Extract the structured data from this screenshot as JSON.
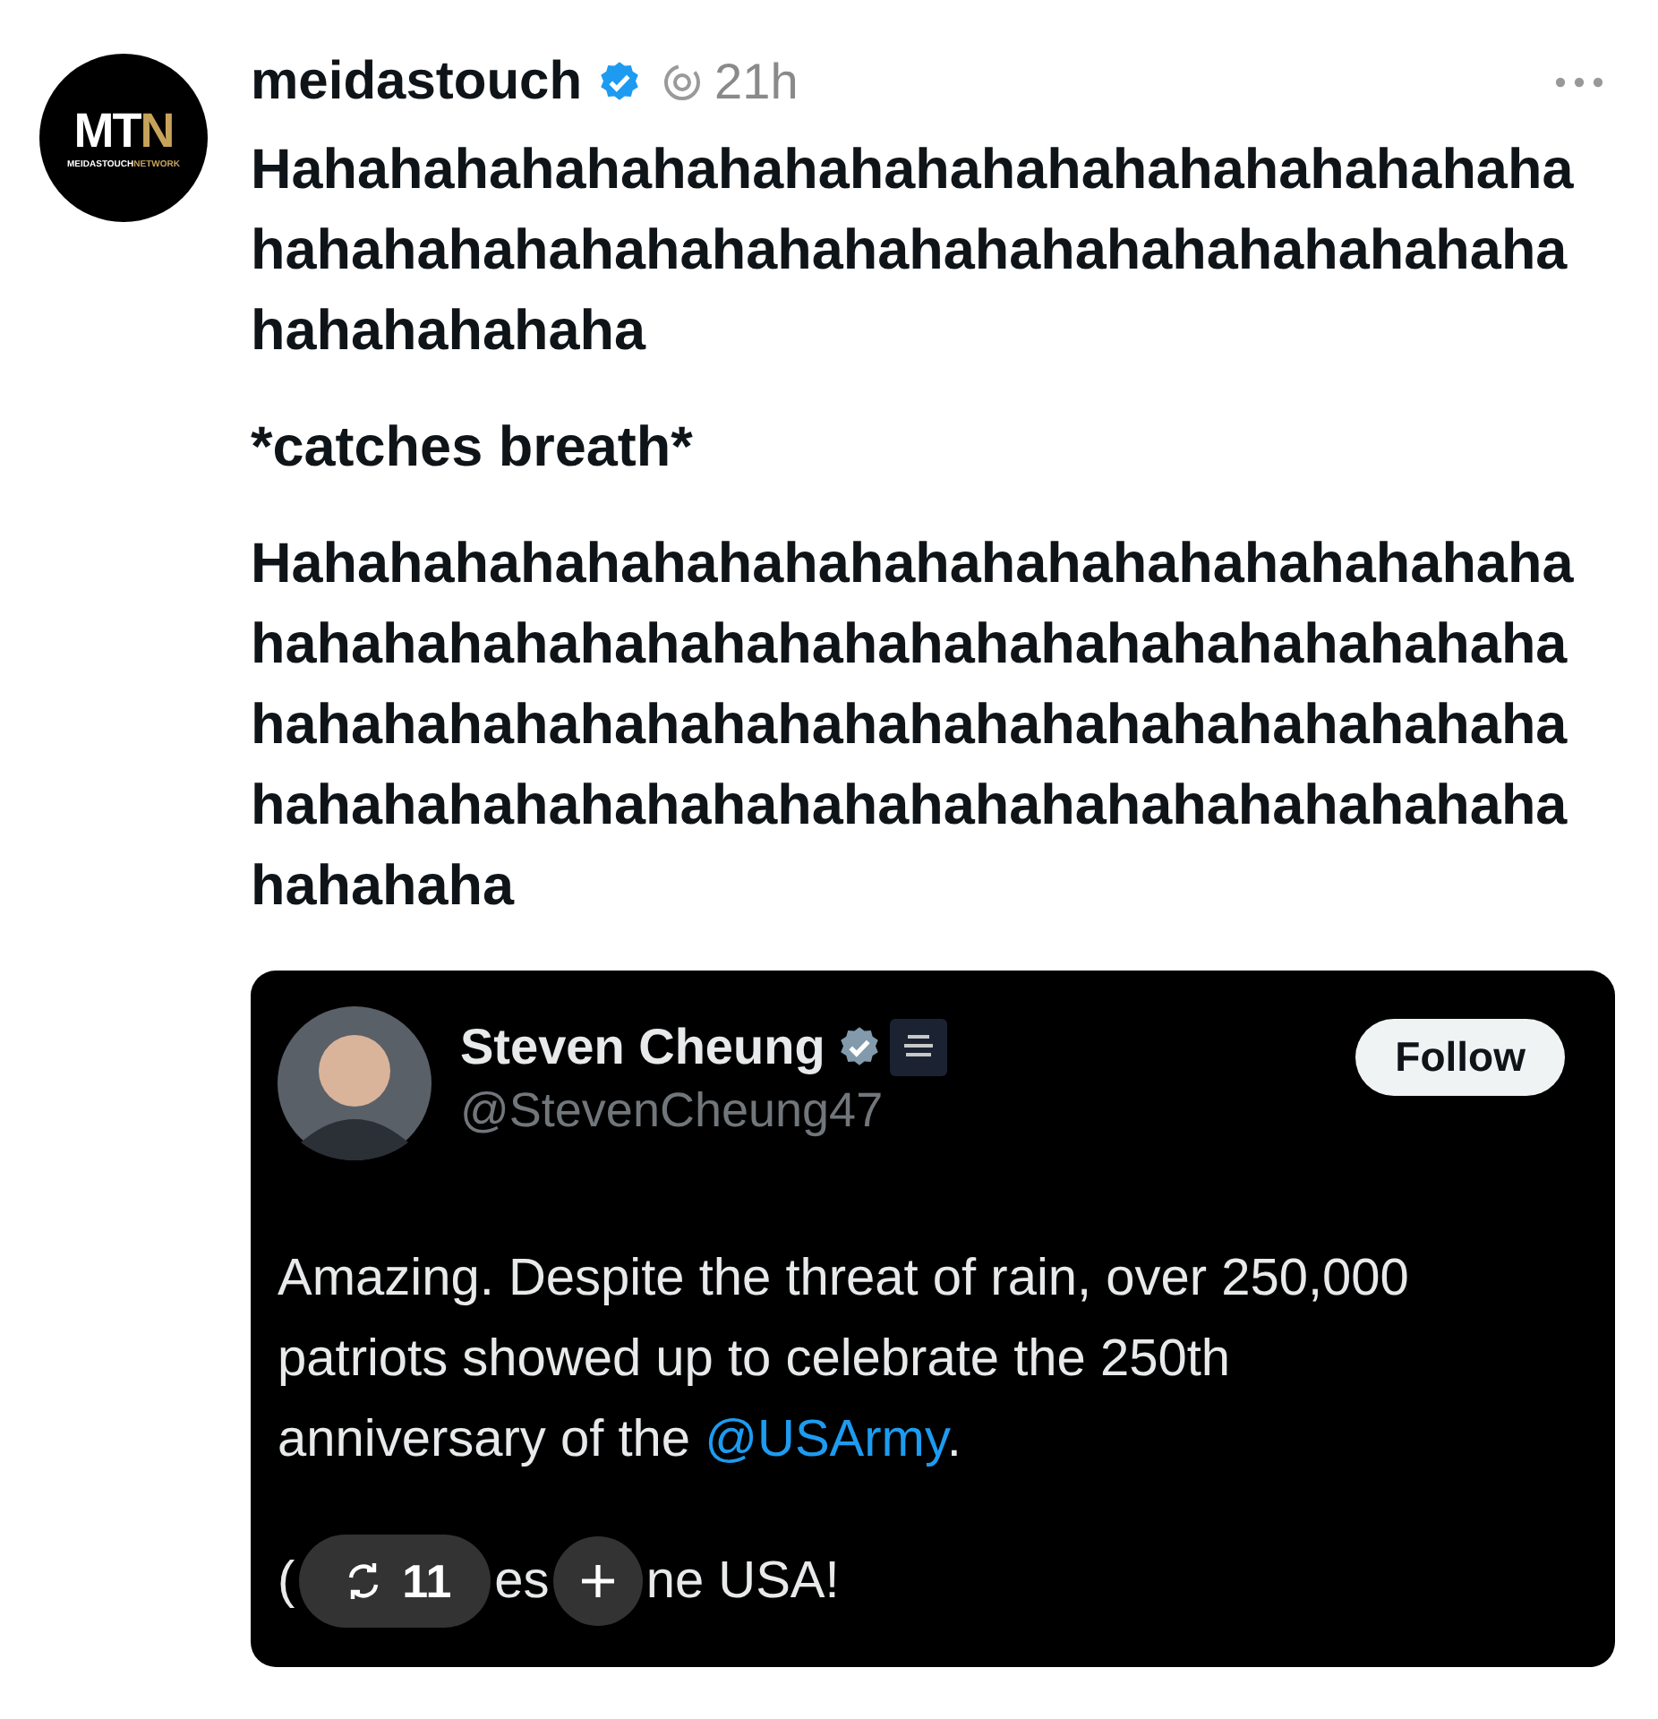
{
  "post": {
    "logo": {
      "mark": "MT",
      "mark_accent": "N",
      "subtitle": "MEIDASTOUCH",
      "subtitle_accent": "NETWORK"
    },
    "author": "meidastouch",
    "verified": true,
    "time": "21h",
    "paragraphs": [
      "Hahahahahahahahahahahahahahahahahahahaha\nhahahahahahahahahahahahahahahahahahahaha\nhahahahahaha",
      "*catches breath*",
      "Hahahahahahahahahahahahahahahahahahahaha\nhahahahahahahahahahahahahahahahahahahaha\nhahahahahahahahahahahahahahahahahahahaha\nhahahahahahahahahahahahahahahahahahahaha\nhahahaha"
    ]
  },
  "quote": {
    "name": "Steven Cheung",
    "verified": true,
    "handle": "@StevenCheung47",
    "follow": "Follow",
    "text_before": "Amazing. Despite the threat of rain, over 250,000\npatriots showed up to celebrate the 250th\nanniversary of the ",
    "mention": "@USArmy",
    "text_after": ".",
    "last_line": [
      {
        "kind": "text",
        "text": "("
      },
      {
        "kind": "repost",
        "text": "11"
      },
      {
        "kind": "text",
        "text": "es"
      },
      {
        "kind": "add"
      },
      {
        "kind": "text",
        "text": "ne USA!"
      }
    ]
  }
}
